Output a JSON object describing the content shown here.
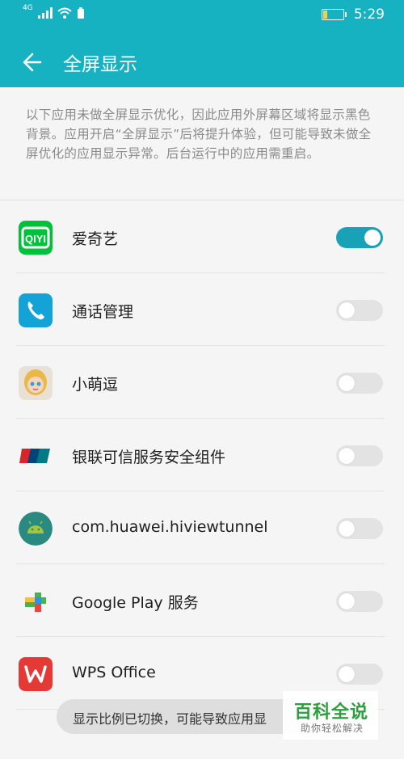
{
  "status_bar": {
    "network": "4G",
    "time": "5:29",
    "icons": [
      "signal-icon",
      "wifi-icon",
      "battery-saver-icon",
      "battery-icon"
    ]
  },
  "header": {
    "title": "全屏显示",
    "back_icon": "back-arrow-icon"
  },
  "description": "以下应用未做全屏显示优化，因此应用外屏幕区域将显示黑色背景。应用开启“全屏显示”后将提升体验，但可能导致未做全屏优化的应用显示异常。后台运行中的应用需重启。",
  "apps": [
    {
      "label": "爱奇艺",
      "enabled": true,
      "icon": "iqiyi-icon"
    },
    {
      "label": "通话管理",
      "enabled": false,
      "icon": "phone-icon"
    },
    {
      "label": "小萌逗",
      "enabled": false,
      "icon": "avatar-game-icon"
    },
    {
      "label": "银联可信服务安全组件",
      "enabled": false,
      "icon": "unionpay-icon"
    },
    {
      "label": "com.huawei.hiviewtunnel",
      "enabled": false,
      "icon": "android-icon"
    },
    {
      "label": "Google Play 服务",
      "enabled": false,
      "icon": "google-play-services-icon"
    },
    {
      "label": "WPS Office",
      "enabled": false,
      "icon": "wps-icon"
    }
  ],
  "toast": "显示比例已切换，可能导致应用显",
  "watermark": {
    "main": "百科全说",
    "sub": "助你轻松解决"
  },
  "colors": {
    "accent": "#17b2c2",
    "toggle_on": "#17a2b8",
    "toggle_off": "#e3e3e3"
  }
}
